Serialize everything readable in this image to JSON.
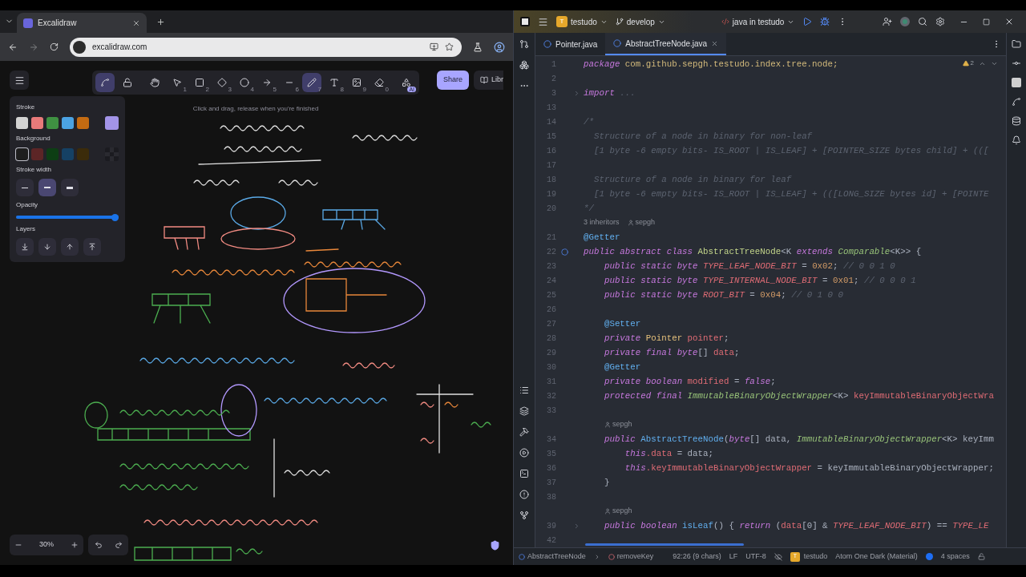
{
  "browser": {
    "tabs": [
      {
        "title": "Excalidraw",
        "selected": true
      }
    ],
    "url": "excalidraw.com"
  },
  "excalidraw": {
    "tools": [
      {
        "kind": "keep",
        "selected": true
      },
      {
        "kind": "lock",
        "selected": false
      },
      {
        "kind": "hand",
        "selected": false
      },
      {
        "kind": "select",
        "key": "1",
        "selected": false
      },
      {
        "kind": "rectangle",
        "key": "2",
        "selected": false
      },
      {
        "kind": "diamond",
        "key": "3",
        "selected": false
      },
      {
        "kind": "ellipse",
        "key": "4",
        "selected": false
      },
      {
        "kind": "arrow",
        "key": "5",
        "selected": false
      },
      {
        "kind": "line",
        "key": "6",
        "selected": false
      },
      {
        "kind": "draw",
        "key": "7",
        "selected": true
      },
      {
        "kind": "text",
        "key": "8",
        "selected": false
      },
      {
        "kind": "image",
        "key": "9",
        "selected": false
      },
      {
        "kind": "eraser",
        "key": "0",
        "selected": false
      },
      {
        "kind": "shapes",
        "badge": "AI",
        "selected": false
      }
    ],
    "hint": "Click and drag, release when you're finished",
    "share": "Share",
    "library": "Libr",
    "panel": {
      "stroke_label": "Stroke",
      "stroke_colors": [
        {
          "color": "#d3d3d3"
        },
        {
          "color": "#e87a7a"
        },
        {
          "color": "#3f9142"
        },
        {
          "color": "#4ba3e3"
        },
        {
          "color": "#c46b12"
        }
      ],
      "stroke_current": {
        "color": "#a394e8"
      },
      "background_label": "Background",
      "background_colors": [
        {
          "kind": "color",
          "color": "#1e1e1e",
          "selected": true
        },
        {
          "kind": "color",
          "color": "#5c2526",
          "selected": false
        },
        {
          "kind": "color",
          "color": "#0d3e14",
          "selected": false
        },
        {
          "kind": "color",
          "color": "#154164",
          "selected": false
        },
        {
          "kind": "color",
          "color": "#3b2b0a",
          "selected": false
        }
      ],
      "background_current": {
        "kind": "transparent"
      },
      "stroke_width_label": "Stroke width",
      "stroke_widths": [
        {
          "kind": "thin",
          "selected": false
        },
        {
          "kind": "bold",
          "selected": true
        },
        {
          "kind": "extra",
          "selected": false
        }
      ],
      "opacity_label": "Opacity",
      "opacity": {
        "level": 1
      },
      "layers_label": "Layers"
    },
    "zoom": "30%"
  },
  "ide": {
    "project_badge": "T",
    "project": "testudo",
    "branch": "develop",
    "run_config": "java in testudo",
    "tabs": [
      {
        "title": "Pointer.java",
        "selected": false
      },
      {
        "title": "AbstractTreeNode.java",
        "selected": true
      }
    ],
    "warnings": "2",
    "lines": [
      {
        "kind": "code",
        "number": "1",
        "tokens": [
          {
            "kind": "kw",
            "text": "package"
          },
          {
            "kind": "pkg",
            "text": " com.github.sepgh.testudo.index.tree.node;"
          }
        ]
      },
      {
        "kind": "code",
        "number": "2"
      },
      {
        "kind": "code",
        "number": "3",
        "folded": true,
        "tokens": [
          {
            "kind": "kw",
            "text": "import"
          },
          {
            "kind": "comment",
            "text": " ..."
          }
        ]
      },
      {
        "kind": "code",
        "number": "13"
      },
      {
        "kind": "code",
        "number": "14",
        "tokens": [
          {
            "kind": "comment",
            "text": "/*"
          }
        ]
      },
      {
        "kind": "code",
        "number": "15",
        "tokens": [
          {
            "kind": "comment",
            "text": "  Structure of a node in binary for non-leaf"
          }
        ]
      },
      {
        "kind": "code",
        "number": "16",
        "tokens": [
          {
            "kind": "comment",
            "text": "  [1 byte -6 empty bits- IS_ROOT | IS_LEAF] + [POINTER_SIZE bytes child] + ((["
          }
        ]
      },
      {
        "kind": "code",
        "number": "17"
      },
      {
        "kind": "code",
        "number": "18",
        "tokens": [
          {
            "kind": "comment",
            "text": "  Structure of a node in binary for leaf"
          }
        ]
      },
      {
        "kind": "code",
        "number": "19",
        "tokens": [
          {
            "kind": "comment",
            "text": "  [1 byte -6 empty bits- IS_ROOT | IS_LEAF] + (([LONG_SIZE bytes id] + [POINTE"
          }
        ]
      },
      {
        "kind": "code",
        "number": "20",
        "tokens": [
          {
            "kind": "comment",
            "text": "*/"
          }
        ]
      },
      {
        "kind": "hint",
        "indent": false,
        "items": [
          {
            "kind": "inheritors",
            "text": "3 inheritors"
          },
          {
            "kind": "author",
            "text": "sepgh"
          }
        ]
      },
      {
        "kind": "code",
        "number": "21",
        "tokens": [
          {
            "kind": "ann",
            "text": "@Getter"
          }
        ]
      },
      {
        "kind": "code",
        "number": "22",
        "marker": true,
        "tokens": [
          {
            "kind": "kw",
            "text": "public abstract class "
          },
          {
            "kind": "decl",
            "text": "AbstractTreeNode"
          },
          {
            "kind": "plain",
            "text": "<K "
          },
          {
            "kind": "kw",
            "text": "extends "
          },
          {
            "kind": "typei",
            "text": "Comparable"
          },
          {
            "kind": "plain",
            "text": "<K>> {"
          }
        ]
      },
      {
        "kind": "code",
        "number": "23",
        "tokens": [
          {
            "kind": "kw",
            "text": "    public static byte "
          },
          {
            "kind": "const",
            "text": "TYPE_LEAF_NODE_BIT"
          },
          {
            "kind": "plain",
            "text": " = "
          },
          {
            "kind": "num",
            "text": "0x02"
          },
          {
            "kind": "plain",
            "text": ";"
          },
          {
            "kind": "comment",
            "text": " // 0 0 1 0"
          }
        ]
      },
      {
        "kind": "code",
        "number": "24",
        "tokens": [
          {
            "kind": "kw",
            "text": "    public static byte "
          },
          {
            "kind": "const",
            "text": "TYPE_INTERNAL_NODE_BIT"
          },
          {
            "kind": "plain",
            "text": " = "
          },
          {
            "kind": "num",
            "text": "0x01"
          },
          {
            "kind": "plain",
            "text": ";"
          },
          {
            "kind": "comment",
            "text": " // 0 0 0 1"
          }
        ]
      },
      {
        "kind": "code",
        "number": "25",
        "tokens": [
          {
            "kind": "kw",
            "text": "    public static byte "
          },
          {
            "kind": "const",
            "text": "ROOT_BIT"
          },
          {
            "kind": "plain",
            "text": " = "
          },
          {
            "kind": "num",
            "text": "0x04"
          },
          {
            "kind": "plain",
            "text": ";"
          },
          {
            "kind": "comment",
            "text": " // 0 1 0 0"
          }
        ]
      },
      {
        "kind": "code",
        "number": "26"
      },
      {
        "kind": "code",
        "number": "27",
        "tokens": [
          {
            "kind": "ann",
            "text": "    @Setter"
          }
        ]
      },
      {
        "kind": "code",
        "number": "28",
        "tokens": [
          {
            "kind": "kw",
            "text": "    private "
          },
          {
            "kind": "type",
            "text": "Pointer "
          },
          {
            "kind": "field",
            "text": "pointer"
          },
          {
            "kind": "plain",
            "text": ";"
          }
        ]
      },
      {
        "kind": "code",
        "number": "29",
        "tokens": [
          {
            "kind": "kw",
            "text": "    private final byte"
          },
          {
            "kind": "plain",
            "text": "[] "
          },
          {
            "kind": "field",
            "text": "data"
          },
          {
            "kind": "plain",
            "text": ";"
          }
        ]
      },
      {
        "kind": "code",
        "number": "30",
        "tokens": [
          {
            "kind": "ann",
            "text": "    @Getter"
          }
        ]
      },
      {
        "kind": "code",
        "number": "31",
        "tokens": [
          {
            "kind": "kw",
            "text": "    private boolean "
          },
          {
            "kind": "field",
            "text": "modified"
          },
          {
            "kind": "plain",
            "text": " = "
          },
          {
            "kind": "kw",
            "text": "false"
          },
          {
            "kind": "plain",
            "text": ";"
          }
        ]
      },
      {
        "kind": "code",
        "number": "32",
        "tokens": [
          {
            "kind": "kw",
            "text": "    protected final "
          },
          {
            "kind": "typei",
            "text": "ImmutableBinaryObjectWrapper"
          },
          {
            "kind": "plain",
            "text": "<K> "
          },
          {
            "kind": "field",
            "text": "keyImmutableBinaryObjectWra"
          }
        ]
      },
      {
        "kind": "code",
        "number": "33"
      },
      {
        "kind": "hint",
        "indent": true,
        "items": [
          {
            "kind": "author",
            "text": "sepgh"
          }
        ]
      },
      {
        "kind": "code",
        "number": "34",
        "tokens": [
          {
            "kind": "kw",
            "text": "    public "
          },
          {
            "kind": "fn",
            "text": "AbstractTreeNode"
          },
          {
            "kind": "plain",
            "text": "("
          },
          {
            "kind": "kw",
            "text": "byte"
          },
          {
            "kind": "plain",
            "text": "[] data, "
          },
          {
            "kind": "typei",
            "text": "ImmutableBinaryObjectWrapper"
          },
          {
            "kind": "plain",
            "text": "<K> keyImm"
          }
        ]
      },
      {
        "kind": "code",
        "number": "35",
        "tokens": [
          {
            "kind": "kw",
            "text": "        this"
          },
          {
            "kind": "field",
            "text": ".data"
          },
          {
            "kind": "plain",
            "text": " = data;"
          }
        ]
      },
      {
        "kind": "code",
        "number": "36",
        "tokens": [
          {
            "kind": "kw",
            "text": "        this"
          },
          {
            "kind": "field",
            "text": ".keyImmutableBinaryObjectWrapper"
          },
          {
            "kind": "plain",
            "text": " = keyImmutableBinaryObjectWrapper;"
          }
        ]
      },
      {
        "kind": "code",
        "number": "37",
        "tokens": [
          {
            "kind": "plain",
            "text": "    }"
          }
        ]
      },
      {
        "kind": "code",
        "number": "38"
      },
      {
        "kind": "hint",
        "indent": true,
        "items": [
          {
            "kind": "author",
            "text": "sepgh"
          }
        ]
      },
      {
        "kind": "code",
        "number": "39",
        "folded": true,
        "tokens": [
          {
            "kind": "kw",
            "text": "    public boolean "
          },
          {
            "kind": "fn",
            "text": "isLeaf"
          },
          {
            "kind": "plain",
            "text": "() { "
          },
          {
            "kind": "kw",
            "text": "return"
          },
          {
            "kind": "plain",
            "text": " ("
          },
          {
            "kind": "field",
            "text": "data"
          },
          {
            "kind": "plain",
            "text": "[0] & "
          },
          {
            "kind": "const",
            "text": "TYPE_LEAF_NODE_BIT"
          },
          {
            "kind": "plain",
            "text": ") == "
          },
          {
            "kind": "const",
            "text": "TYPE_LE"
          }
        ]
      },
      {
        "kind": "code",
        "number": "42"
      }
    ],
    "status": {
      "breadcrumbs": [
        {
          "kind": "class",
          "text": "AbstractTreeNode"
        },
        {
          "kind": "method",
          "text": "removeKey"
        }
      ],
      "position": "92:26 (9 chars)",
      "line_ending": "LF",
      "encoding": "UTF-8",
      "project_badge": "T",
      "project": "testudo",
      "theme": "Atom One Dark (Material)",
      "indent": "4 spaces"
    }
  }
}
